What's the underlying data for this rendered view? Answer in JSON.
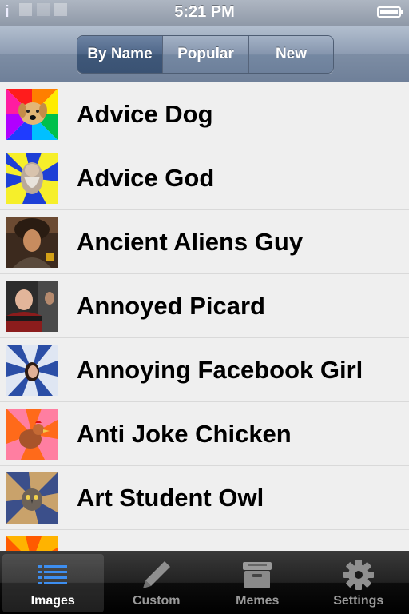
{
  "status_bar": {
    "carrier": "i",
    "time": "5:21 PM"
  },
  "segmented_control": {
    "segments": [
      "By Name",
      "Popular",
      "New"
    ],
    "selected": "By Name"
  },
  "list": {
    "items": [
      {
        "label": "Advice Dog",
        "thumb_colors": [
          "#ff1c1c",
          "#ffec00",
          "#1f3cff",
          "#ff7f00",
          "#b000ff",
          "#00c0ff"
        ]
      },
      {
        "label": "Advice God",
        "thumb_colors": [
          "#f6ef2a",
          "#1d3fd6"
        ]
      },
      {
        "label": "Ancient Aliens Guy",
        "thumb_colors": [
          "#5a3a24",
          "#b57c52"
        ]
      },
      {
        "label": "Annoyed Picard",
        "thumb_colors": [
          "#2a2a2a",
          "#8b1c1c"
        ]
      },
      {
        "label": "Annoying Facebook Girl",
        "thumb_colors": [
          "#2b4ea6",
          "#dfe6f3"
        ]
      },
      {
        "label": "Anti Joke Chicken",
        "thumb_colors": [
          "#ff7ea1",
          "#ff6a1a"
        ]
      },
      {
        "label": "Art Student Owl",
        "thumb_colors": [
          "#3b4f8a",
          "#c9a26b"
        ]
      },
      {
        "label": "",
        "thumb_colors": [
          "#ffb300",
          "#ff5a00"
        ]
      }
    ]
  },
  "tab_bar": {
    "tabs": [
      {
        "label": "Images",
        "icon": "list-icon",
        "active": true
      },
      {
        "label": "Custom",
        "icon": "pencil-icon",
        "active": false
      },
      {
        "label": "Memes",
        "icon": "archive-box-icon",
        "active": false
      },
      {
        "label": "Settings",
        "icon": "gear-icon",
        "active": false
      }
    ]
  }
}
